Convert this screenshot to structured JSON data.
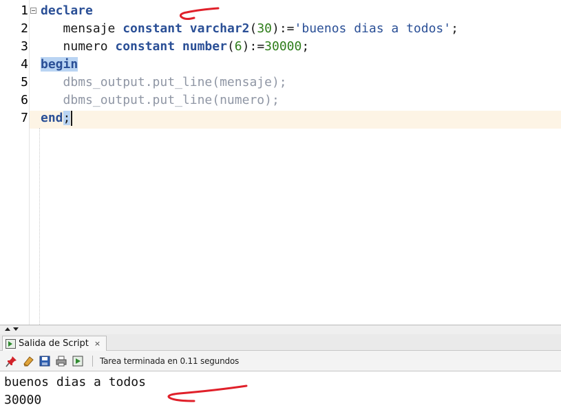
{
  "editor": {
    "line_numbers": [
      "1",
      "2",
      "3",
      "4",
      "5",
      "6",
      "7"
    ],
    "lines": {
      "l1": {
        "kw": "declare"
      },
      "l2": {
        "indent": "   ",
        "ident": "mensaje ",
        "kw1": "constant",
        "sp1": " ",
        "kw2": "varchar2",
        "p1": "(",
        "num": "30",
        "p2": "):=",
        "str": "'buenos dias a todos'",
        "end": ";"
      },
      "l3": {
        "indent": "   ",
        "ident": "numero ",
        "kw1": "constant",
        "sp1": " ",
        "kw2": "number",
        "p1": "(",
        "num1": "6",
        "p2": "):=",
        "num2": "30000",
        "end": ";"
      },
      "l4": {
        "kw": "begin"
      },
      "l5": {
        "indent": "   ",
        "text": "dbms_output.put_line(mensaje);"
      },
      "l6": {
        "indent": "   ",
        "text": "dbms_output.put_line(numero);"
      },
      "l7": {
        "kw": "end",
        "sel": ";"
      }
    }
  },
  "output_panel": {
    "tab_label": "Salida de Script",
    "tab_close": "×",
    "status_text": "Tarea terminada en 0.11 segundos",
    "output_lines": [
      "buenos dias a todos",
      "30000"
    ]
  },
  "icons": {
    "pin": "pin-icon",
    "eraser": "eraser-icon",
    "save": "save-icon",
    "print": "print-icon",
    "run": "run-script-icon"
  },
  "colors": {
    "keyword": "#2a4f96",
    "number": "#2e7d1a",
    "comment_like": "#8f96a4",
    "selection": "#b9d4f3",
    "current_line": "#fdf4e5",
    "annotation": "#e0202a"
  }
}
